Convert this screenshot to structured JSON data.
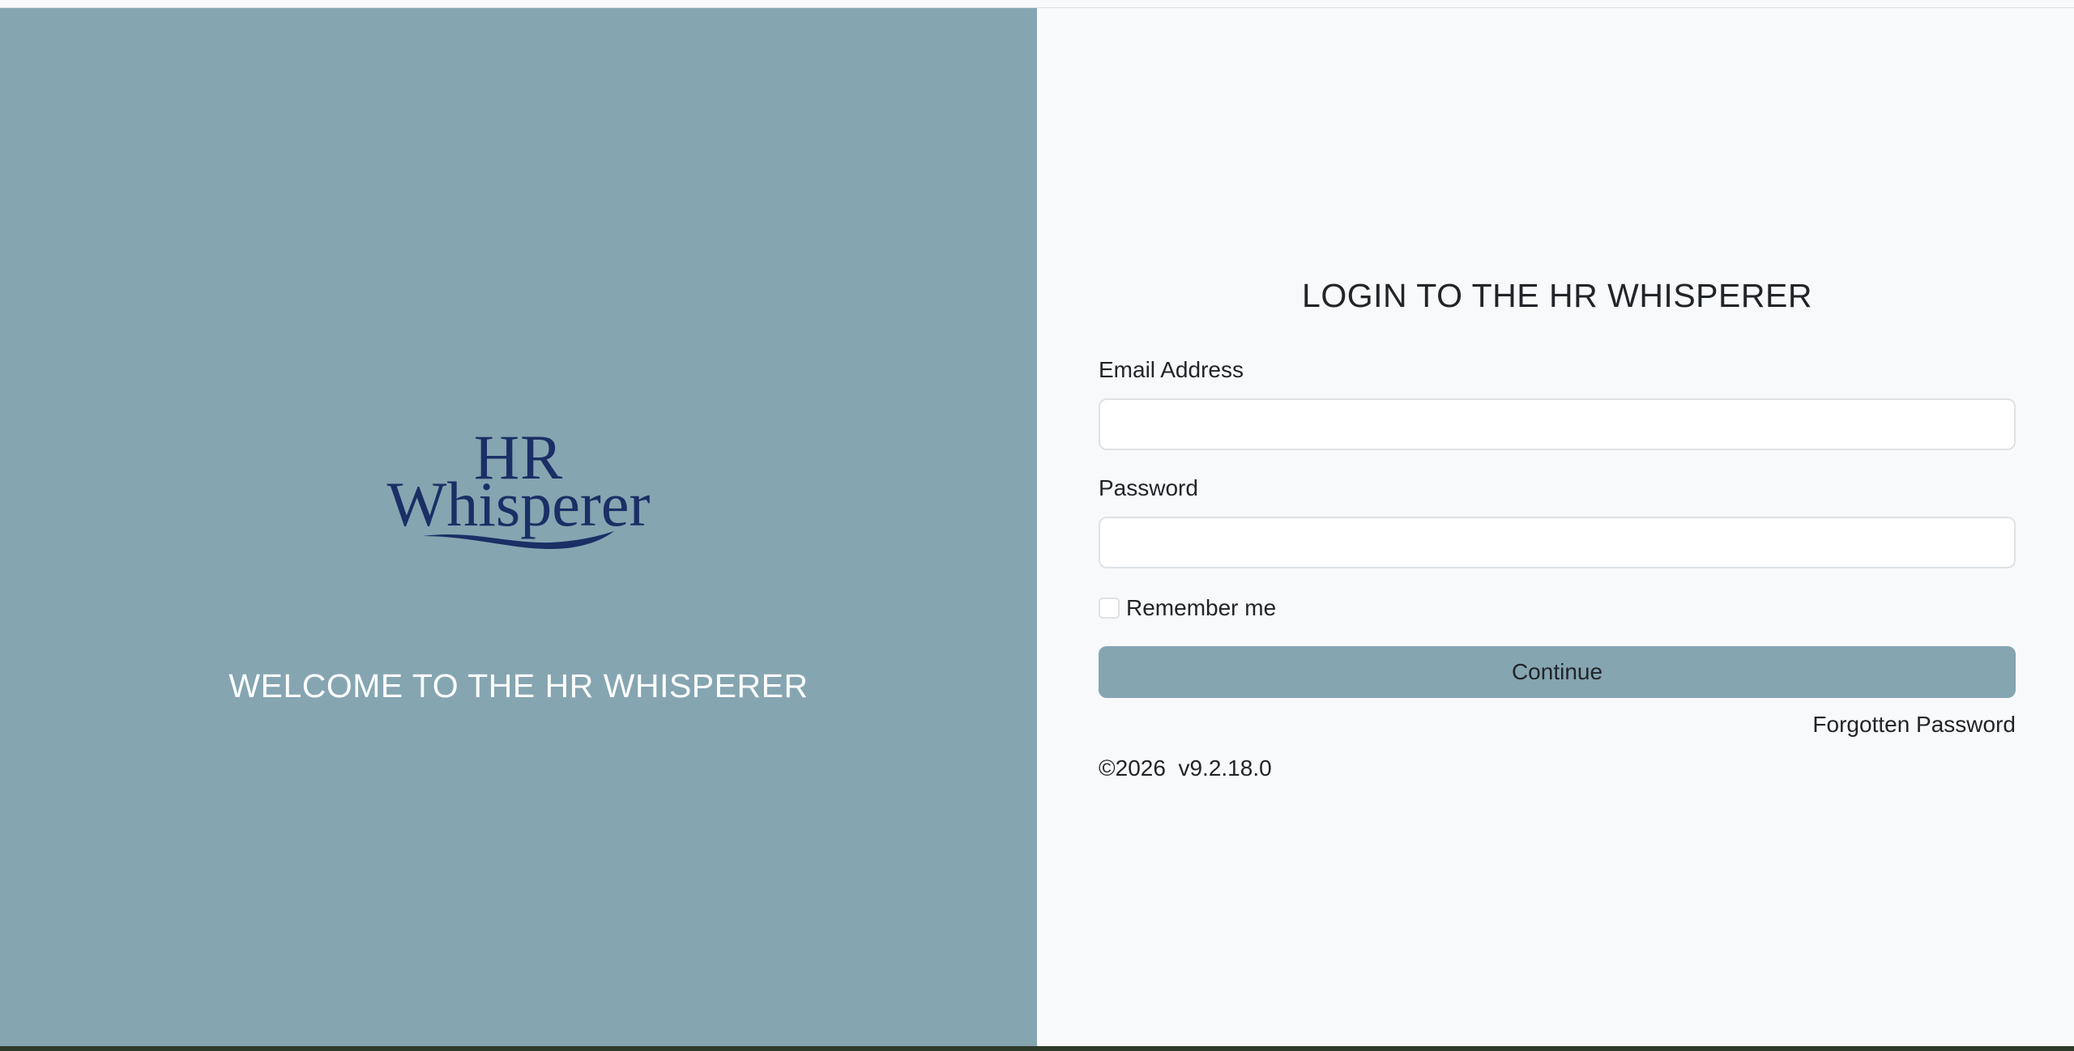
{
  "left_panel": {
    "logo": {
      "line1": "HR",
      "line2": "Whisperer"
    },
    "welcome_text": "WELCOME TO THE HR WHISPERER",
    "background_color": "#85a5b1",
    "logo_color": "#1a2f65"
  },
  "login": {
    "title": "LOGIN TO THE HR WHISPERER",
    "email_label": "Email Address",
    "email_value": "",
    "password_label": "Password",
    "password_value": "",
    "remember_label": "Remember me",
    "remember_checked": false,
    "continue_label": "Continue",
    "forgot_label": "Forgotten Password",
    "footer": "©2026  v9.2.18.0",
    "button_color": "#85a5b1"
  }
}
